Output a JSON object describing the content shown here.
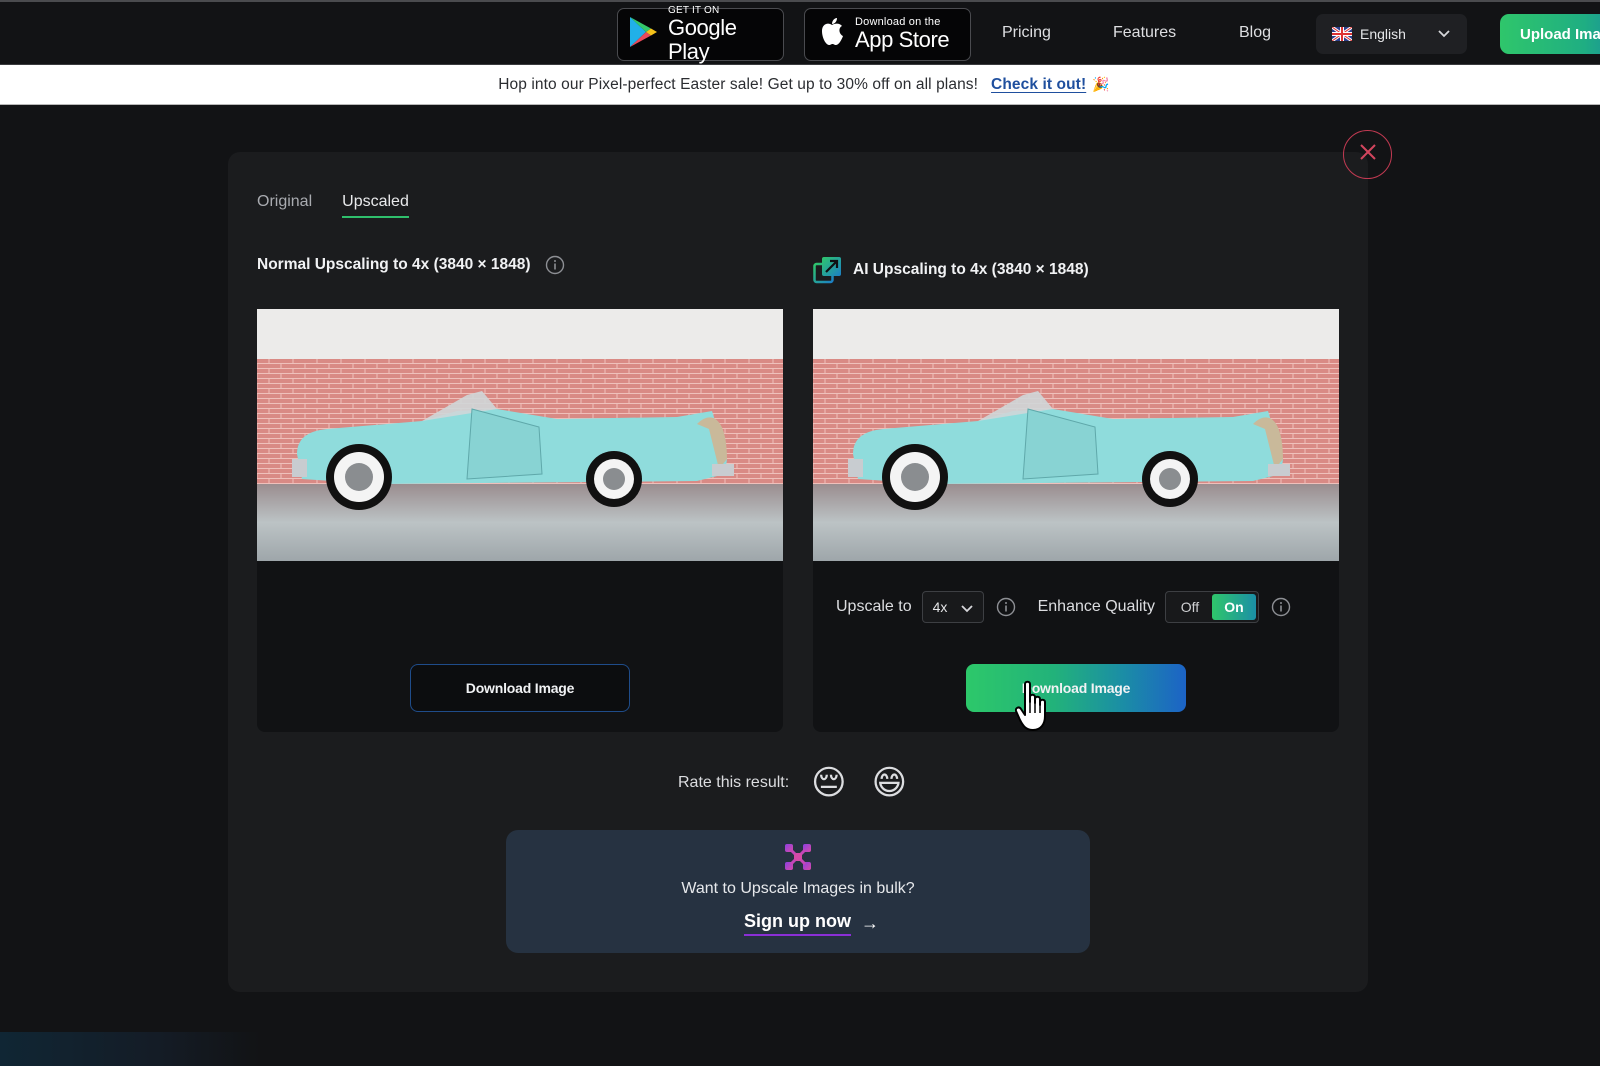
{
  "header": {
    "google_play": {
      "small": "GET IT ON",
      "big": "Google Play"
    },
    "app_store": {
      "small": "Download on the",
      "big": "App Store"
    },
    "nav": [
      "Pricing",
      "Features",
      "Blog"
    ],
    "language": {
      "selected": "English",
      "flag": "uk-flag-icon"
    },
    "upload_label": "Upload Image"
  },
  "banner": {
    "message": "Hop into our Pixel-perfect Easter sale! Get up to 30% off on all plans!",
    "link": "Check it out!",
    "emoji": "🎉"
  },
  "modal": {
    "tabs": [
      {
        "label": "Original",
        "active": false
      },
      {
        "label": "Upscaled",
        "active": true
      }
    ],
    "left": {
      "heading": "Normal Upscaling to 4x (3840 × 1848)",
      "download_label": "Download Image"
    },
    "right": {
      "heading": "AI Upscaling to 4x (3840 × 1848)",
      "upscale_label": "Upscale to",
      "upscale_value": "4x",
      "enhance_label": "Enhance Quality",
      "toggle_off": "Off",
      "toggle_on": "On",
      "enhance_state": "On",
      "download_label": "Download Image"
    },
    "rating": {
      "label": "Rate this result:",
      "options": [
        "😔",
        "😄"
      ]
    },
    "bulk": {
      "question": "Want to Upscale Images in bulk?",
      "cta": "Sign up now",
      "arrow": "→"
    }
  },
  "colors": {
    "accent_green": "#2fc66b",
    "accent_blue": "#1c63c6",
    "close_red": "#c23a52",
    "link_blue": "#1f4f9e"
  }
}
